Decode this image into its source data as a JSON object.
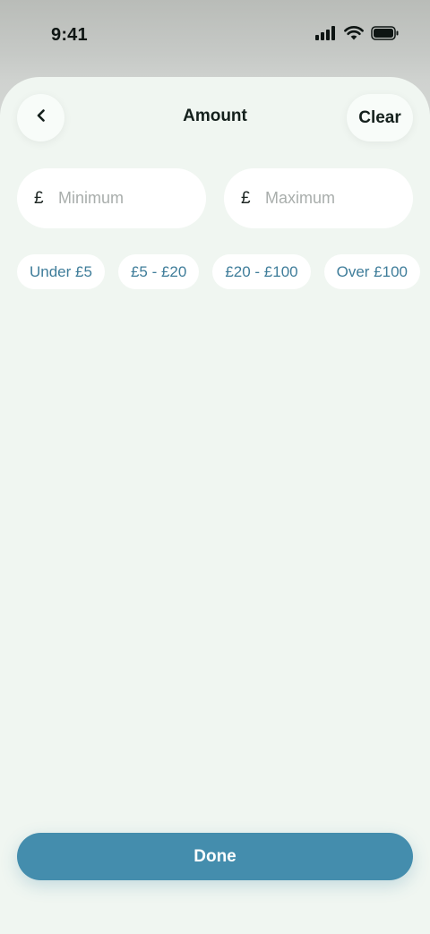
{
  "status_bar": {
    "time": "9:41"
  },
  "header": {
    "title": "Amount",
    "back_icon": "chevron-left-icon",
    "clear_label": "Clear"
  },
  "inputs": {
    "minimum": {
      "currency": "£",
      "placeholder": "Minimum",
      "value": ""
    },
    "maximum": {
      "currency": "£",
      "placeholder": "Maximum",
      "value": ""
    }
  },
  "presets": [
    {
      "label": "Under £5"
    },
    {
      "label": "£5 - £20"
    },
    {
      "label": "£20 - £100"
    },
    {
      "label": "Over £100"
    }
  ],
  "footer": {
    "done_label": "Done"
  },
  "colors": {
    "accent": "#448dad",
    "chip_text": "#3f7d9a",
    "sheet_background": "#f0f6f1"
  }
}
